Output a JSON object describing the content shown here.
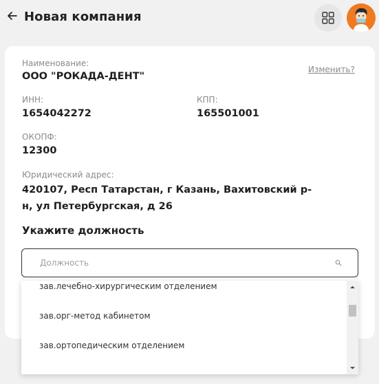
{
  "header": {
    "title": "Новая компания",
    "back_icon": "arrow-left-icon",
    "apps_icon": "grid-icon",
    "avatar_icon": "user-avatar"
  },
  "company": {
    "name_label": "Наименование:",
    "name_value": "ООО \"РОКАДА-ДЕНТ\"",
    "change_link": "Изменить?",
    "inn_label": "ИНН:",
    "inn_value": "1654042272",
    "kpp_label": "КПП:",
    "kpp_value": "165501001",
    "okopf_label": "ОКОПФ:",
    "okopf_value": "12300",
    "address_label": "Юридический адрес:",
    "address_value": "420107, Респ Татарстан, г Казань, Вахитовский р-н, ул Петербургская, д 26"
  },
  "position": {
    "section_title": "Укажите должность",
    "placeholder": "Должность",
    "search_icon": "search-icon"
  },
  "dropdown": {
    "items": [
      "зав.лечебно-хирургическим отделением",
      "зав.орг-метод кабинетом",
      "зав.ортопедическим отделением"
    ],
    "scroll_up_icon": "caret-up-icon",
    "scroll_down_icon": "caret-down-icon"
  },
  "colors": {
    "background": "#f1f1f1",
    "card": "#ffffff",
    "avatar": "#f07a22",
    "text": "#1f1f1f",
    "muted": "#8a8a8a"
  }
}
